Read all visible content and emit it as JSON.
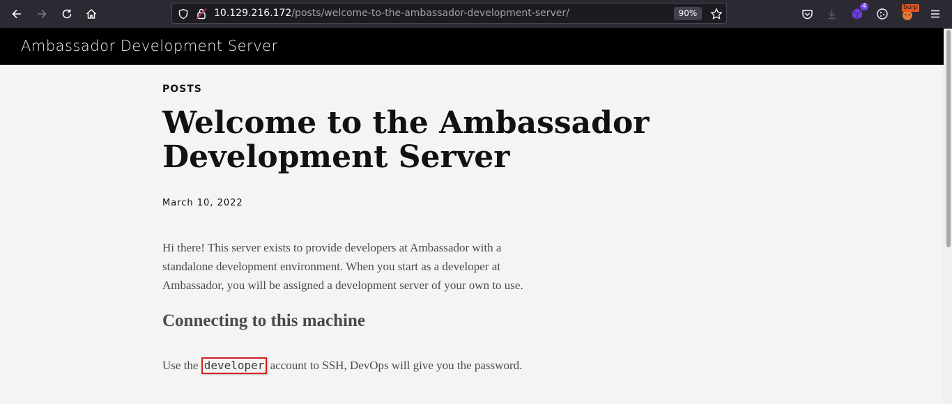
{
  "browser": {
    "url_host": "10.129.216.172",
    "url_path": "/posts/welcome-to-the-ambassador-development-server/",
    "zoom": "90%",
    "extension_badge_count": "4",
    "burp_label": "burp"
  },
  "site": {
    "title": "Ambassador Development Server"
  },
  "post": {
    "section": "POSTS",
    "title": "Welcome to the Ambassador Development Server",
    "date": "March 10, 2022",
    "intro": "Hi there! This server exists to provide developers at Ambassador with a standalone development environment. When you start as a developer at Ambassador, you will be assigned a development server of your own to use.",
    "heading": "Connecting to this machine",
    "connect_before": "Use the",
    "connect_code": "developer",
    "connect_after": "account to SSH, DevOps will give you the password."
  },
  "colors": {
    "page_bg": "#f4f4f4",
    "header_bg": "#000000",
    "toolbar_bg": "#2b2a33",
    "highlight": "#d42020"
  }
}
